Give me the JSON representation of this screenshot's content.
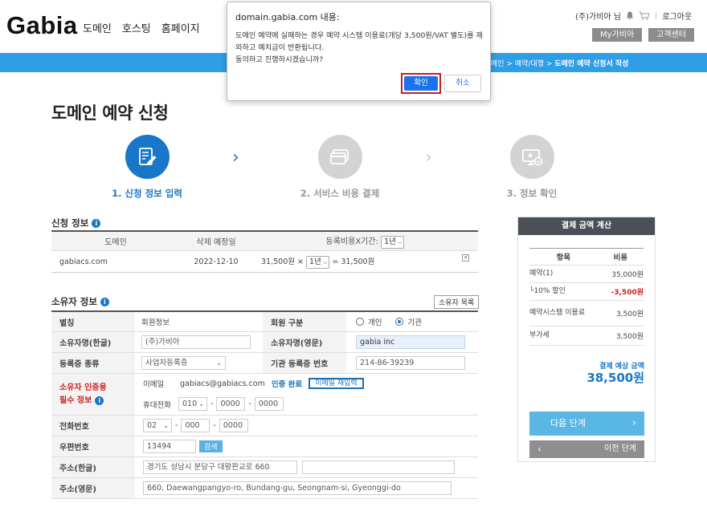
{
  "header": {
    "logo": "Gabia",
    "nav": [
      "도메인",
      "호스팅",
      "홈페이지"
    ],
    "user": "(주)가비아 님",
    "logout": "로그아웃",
    "my_btn": "My가비아",
    "support_btn": "고객센터",
    "breadcrumb_pre": "메인 > 예약/대행 > ",
    "breadcrumb_current": "도메인 예약 신청서 작성"
  },
  "page_title": "도메인 예약 신청",
  "steps": [
    {
      "label": "1. 신청 정보 입력",
      "state": "active"
    },
    {
      "label": "2. 서비스 비용 결제",
      "state": "inactive"
    },
    {
      "label": "3. 정보 확인",
      "state": "inactive"
    }
  ],
  "application": {
    "heading": "신청 정보",
    "col_domain": "도메인",
    "col_delete_date": "삭제 예정일",
    "col_fee_period": "등록비용X기간:",
    "period_header_value": "1년",
    "row": {
      "domain": "gabiacs.com",
      "delete_date": "2022-12-10",
      "fee": "31,500원 ×",
      "period": "1년",
      "total": "= 31,500원"
    }
  },
  "owner": {
    "heading": "소유자 정보",
    "list_btn": "소유자 목록",
    "rows": {
      "type_label": "별칭",
      "type_value": "회원정보",
      "member_label": "회원 구분",
      "opt_personal": "개인",
      "opt_org": "기관",
      "name_kr_label": "소유자명(한글)",
      "name_kr_value": "(주)가비아",
      "name_en_label": "소유자명(영문)",
      "name_en_value": "gabia inc",
      "cert_type_label": "등록증 종류",
      "cert_type_value": "사업자등록증",
      "cert_no_label": "기관 등록증 번호",
      "cert_no_value": "214-86-39239",
      "auth_label1": "소유자 인증용",
      "auth_label2": "필수 정보",
      "email_label": "이메일",
      "email_value": "gabiacs@gabiacs.com",
      "auth_done": "인증 완료",
      "reauth": "이메일 재입력",
      "mobile_label": "휴대전화",
      "mobile_1": "010",
      "mobile_2": "0000",
      "mobile_3": "0000",
      "phone_label": "전화번호",
      "phone_1": "02",
      "phone_2": "000",
      "phone_3": "0000",
      "zip_label": "우편번호",
      "zip_value": "13494",
      "zip_btn": "검색",
      "addr_kr_label": "주소(한글)",
      "addr_kr_value": "경기도 성남시 분당구 대왕판교로 660",
      "addr_en_label": "주소(영문)",
      "addr_en_value": "660, Daewangpangyo-ro, Bundang-gu, Seongnam-si, Gyeonggi-do"
    }
  },
  "payment": {
    "heading": "결제 금액 계산",
    "col_item": "항목",
    "col_cost": "비용",
    "items": [
      {
        "k": "예약(1)",
        "v": "35,000원",
        "red": false
      },
      {
        "k": "└10% 할인",
        "v": "-3,500원",
        "red": true
      },
      {
        "k": "예약시스템 이용료",
        "v": "3,500원",
        "red": false
      },
      {
        "k": "부가세",
        "v": "3,500원",
        "red": false
      }
    ],
    "total_label": "결제 예상 금액",
    "total_value": "38,500원",
    "next": "다음 단계",
    "prev": "이전 단계"
  },
  "dialog": {
    "title": "domain.gabia.com 내용:",
    "message1": "도메인 예약에 실패하는 경우 예약 시스템 이용료(개당 3,500원/VAT 별도)를 제외하고 예치금이 반환됩니다.",
    "message2": "동의하고 진행하시겠습니까?",
    "ok": "확인",
    "cancel": "취소"
  }
}
